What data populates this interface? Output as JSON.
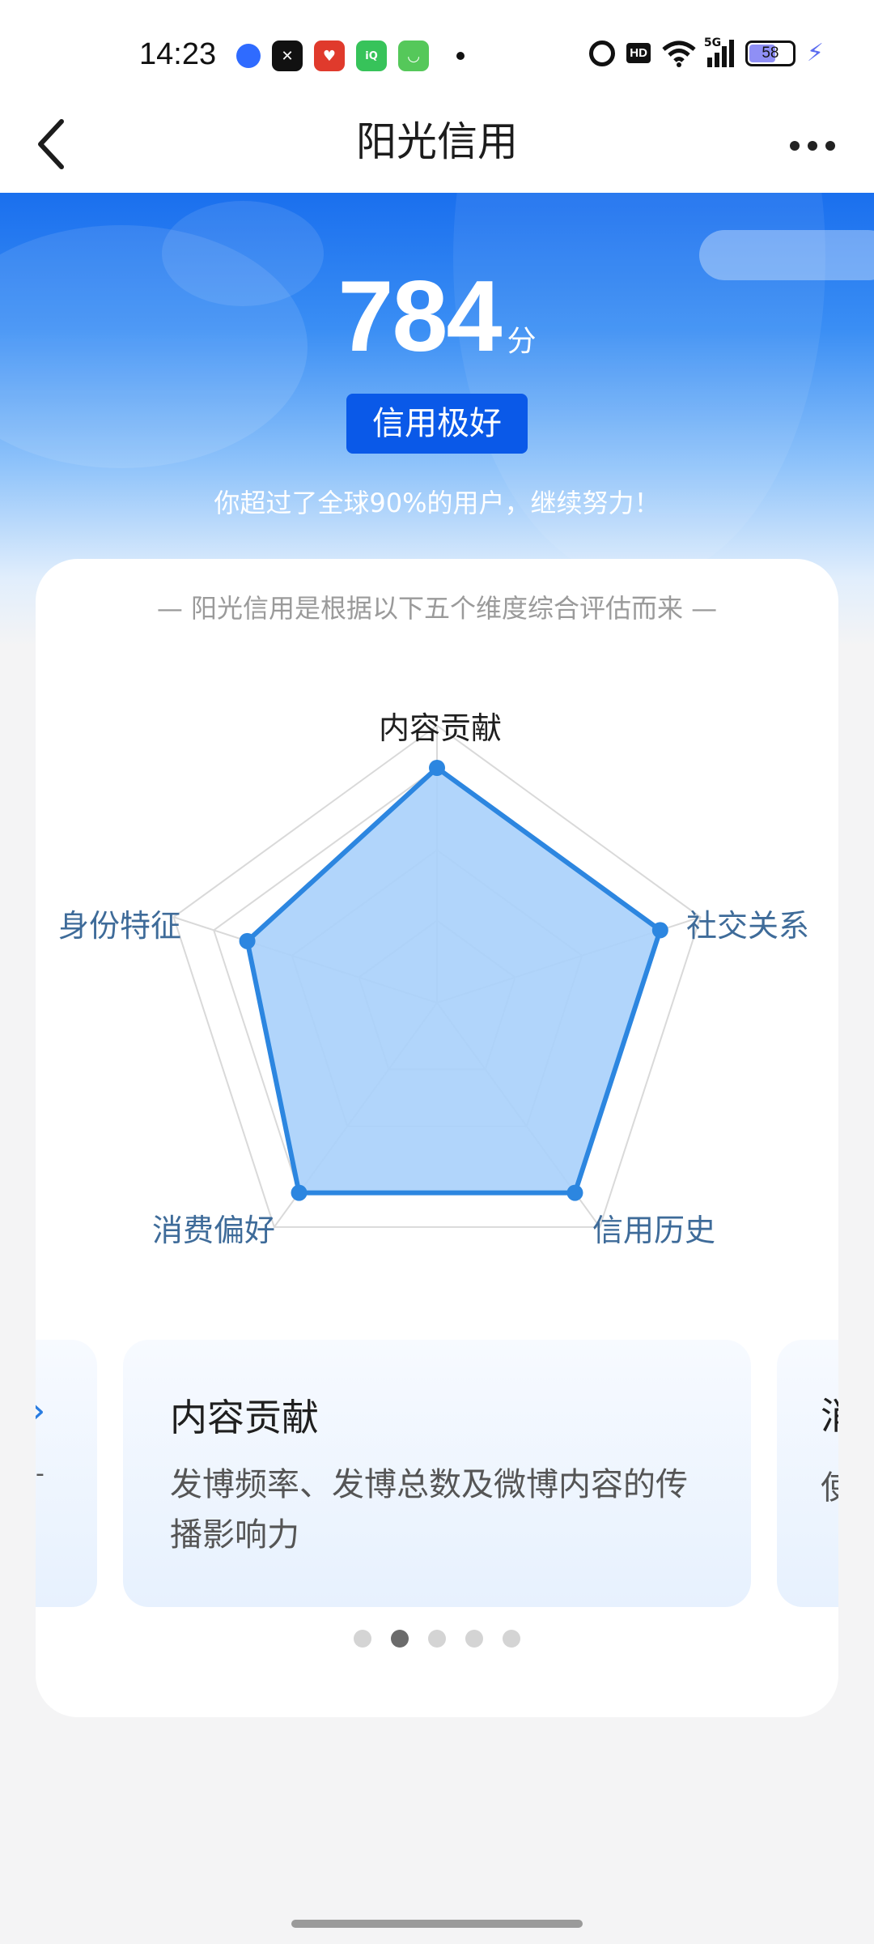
{
  "status_bar": {
    "time": "14:23",
    "battery": "58",
    "network": "5G",
    "hd": "HD",
    "apps": [
      {
        "icon": "blue-drop-app-icon",
        "color": "#2f6bff",
        "glyph": "●"
      },
      {
        "icon": "capcut-app-icon",
        "color": "#111111",
        "glyph": "✕"
      },
      {
        "icon": "red-game-app-icon",
        "color": "#e03a2c",
        "glyph": "♥"
      },
      {
        "icon": "iqiyi-app-icon",
        "color": "#37c35a",
        "glyph": "iQ"
      },
      {
        "icon": "green-chat-app-icon",
        "color": "#55c85a",
        "glyph": "◡"
      }
    ]
  },
  "nav": {
    "title": "阳光信用"
  },
  "hero": {
    "score": "784",
    "unit": "分",
    "level": "信用极好",
    "subtitle": "你超过了全球90%的用户，继续努力！"
  },
  "card": {
    "intro": "— 阳光信用是根据以下五个维度综合评估而来 —"
  },
  "chart_data": {
    "type": "radar",
    "axes": [
      "内容贡献",
      "社交关系",
      "信用历史",
      "消费偏好",
      "身份特征"
    ],
    "values": [
      1.0,
      1.0,
      1.0,
      1.0,
      0.85
    ],
    "max": 1.0,
    "rings": 4,
    "series_color": "#2c86e0",
    "fill_color": "#a9d0fb"
  },
  "carousel": {
    "cards": [
      {
        "title": "内容贡献",
        "desc": "发博频率、发博总数及微博内容的传播影响力"
      }
    ],
    "prev_peek_sub": "-",
    "next_peek_title": "消",
    "next_peek_sub": "使",
    "active_index": 1,
    "total": 5
  }
}
